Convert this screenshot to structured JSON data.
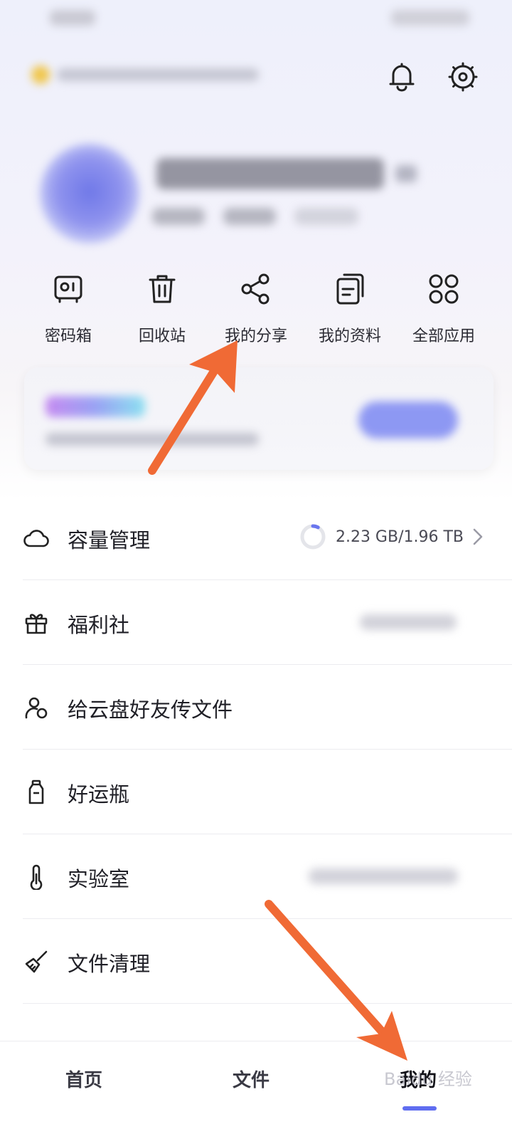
{
  "quick_actions": [
    {
      "label": "密码箱",
      "icon": "safe-icon"
    },
    {
      "label": "回收站",
      "icon": "trash-icon"
    },
    {
      "label": "我的分享",
      "icon": "share-icon"
    },
    {
      "label": "我的资料",
      "icon": "documents-icon"
    },
    {
      "label": "全部应用",
      "icon": "apps-grid-icon"
    }
  ],
  "menu": [
    {
      "label": "容量管理",
      "icon": "cloud-icon",
      "value": "2.23 GB/1.96 TB"
    },
    {
      "label": "福利社",
      "icon": "gift-icon"
    },
    {
      "label": "给云盘好友传文件",
      "icon": "friends-icon"
    },
    {
      "label": "好运瓶",
      "icon": "bottle-icon"
    },
    {
      "label": "实验室",
      "icon": "thermometer-icon"
    },
    {
      "label": "文件清理",
      "icon": "broom-icon"
    }
  ],
  "storage_progress_fraction": 0.0011,
  "bottom_nav": {
    "home": "首页",
    "files": "文件",
    "me": "我的",
    "active": "me"
  },
  "watermark": "Baidu 经验",
  "colors": {
    "accent": "#5f6df0",
    "annotation_arrow": "#f06a35",
    "text_primary": "#1f1f26"
  }
}
